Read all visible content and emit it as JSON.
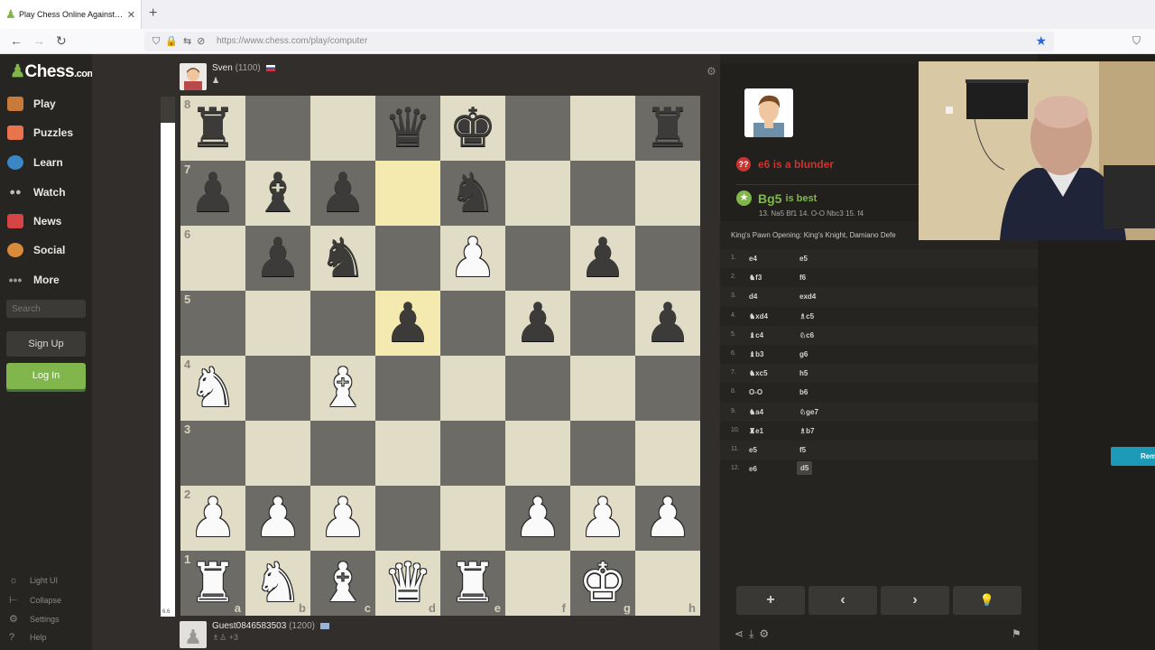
{
  "browser": {
    "tab_title": "Play Chess Online Against the C",
    "tab_close": "✕",
    "new_tab": "+",
    "url": "https://www.chess.com/play/computer"
  },
  "sidebar": {
    "logo": "Chess",
    "logo_suffix": ".com",
    "items": [
      {
        "label": "Play",
        "icon": "play-icon",
        "color": "#c77a3a"
      },
      {
        "label": "Puzzles",
        "icon": "puzzle-icon",
        "color": "#e8734c"
      },
      {
        "label": "Learn",
        "icon": "learn-icon",
        "color": "#3a86c7"
      },
      {
        "label": "Watch",
        "icon": "binoculars-icon",
        "color": "#bdbdbd"
      },
      {
        "label": "News",
        "icon": "news-icon",
        "color": "#d64545"
      },
      {
        "label": "Social",
        "icon": "social-icon",
        "color": "#d98b3a"
      },
      {
        "label": "More",
        "icon": "more-icon",
        "color": "#9a9897"
      }
    ],
    "search_placeholder": "Search",
    "signup": "Sign Up",
    "login": "Log In",
    "bottom": [
      "Light UI",
      "Collapse",
      "Settings",
      "Help"
    ]
  },
  "game": {
    "top_player": {
      "name": "Sven",
      "rating": "(1100)"
    },
    "bottom_player": {
      "name": "Guest0846583503",
      "rating": "(1200)",
      "extra": "+3"
    },
    "eval": "6.6",
    "eval_white_fraction": 0.95,
    "ranks": [
      "8",
      "7",
      "6",
      "5",
      "4",
      "3",
      "2",
      "1"
    ],
    "files": [
      "a",
      "b",
      "c",
      "d",
      "e",
      "f",
      "g",
      "h"
    ],
    "position": [
      [
        "bR",
        "",
        "",
        "bQ",
        "bK",
        "",
        "",
        "bR"
      ],
      [
        "bP",
        "bB",
        "bP",
        "",
        "bN",
        "",
        "",
        ""
      ],
      [
        "",
        "bP",
        "bN",
        "",
        "wP",
        "",
        "bP",
        ""
      ],
      [
        "",
        "",
        "",
        "bP",
        "",
        "bP",
        "",
        "bP"
      ],
      [
        "wN",
        "",
        "wB",
        "",
        "",
        "",
        "",
        ""
      ],
      [
        "",
        "",
        "",
        "",
        "",
        "",
        "",
        ""
      ],
      [
        "wP",
        "wP",
        "wP",
        "",
        "",
        "wP",
        "wP",
        "wP"
      ],
      [
        "wR",
        "wN",
        "wB",
        "wQ",
        "wR",
        "",
        "wK",
        ""
      ]
    ],
    "highlights": [
      "d7",
      "d5"
    ]
  },
  "analysis": {
    "blunder_move": "e6",
    "blunder_text": "is a blunder",
    "best_move": "Bg5",
    "best_text": "is best",
    "best_line": "13. Na5 Bf1 14. O-O Nbc3 15. f4",
    "opening": "King's Pawn Opening: King's Knight, Damiano Defe",
    "moves": [
      {
        "n": "1.",
        "w": "e4",
        "b": "e5"
      },
      {
        "n": "2.",
        "w": "♞f3",
        "b": "f6"
      },
      {
        "n": "3.",
        "w": "d4",
        "b": "exd4"
      },
      {
        "n": "4.",
        "w": "♞xd4",
        "b": "♗c5"
      },
      {
        "n": "5.",
        "w": "♝c4",
        "b": "♘c6"
      },
      {
        "n": "6.",
        "w": "♝b3",
        "b": "g6"
      },
      {
        "n": "7.",
        "w": "♞xc5",
        "b": "h5"
      },
      {
        "n": "8.",
        "w": "O-O",
        "b": "b6"
      },
      {
        "n": "9.",
        "w": "♞a4",
        "b": "♘ge7"
      },
      {
        "n": "10.",
        "w": "♜e1",
        "b": "♗b7"
      },
      {
        "n": "11.",
        "w": "e5",
        "b": "f5"
      },
      {
        "n": "12.",
        "w": "e6",
        "b": "d5"
      }
    ],
    "controls": [
      "+",
      "‹",
      "›",
      "💡"
    ]
  },
  "overlay": {
    "remind": "Remi"
  }
}
